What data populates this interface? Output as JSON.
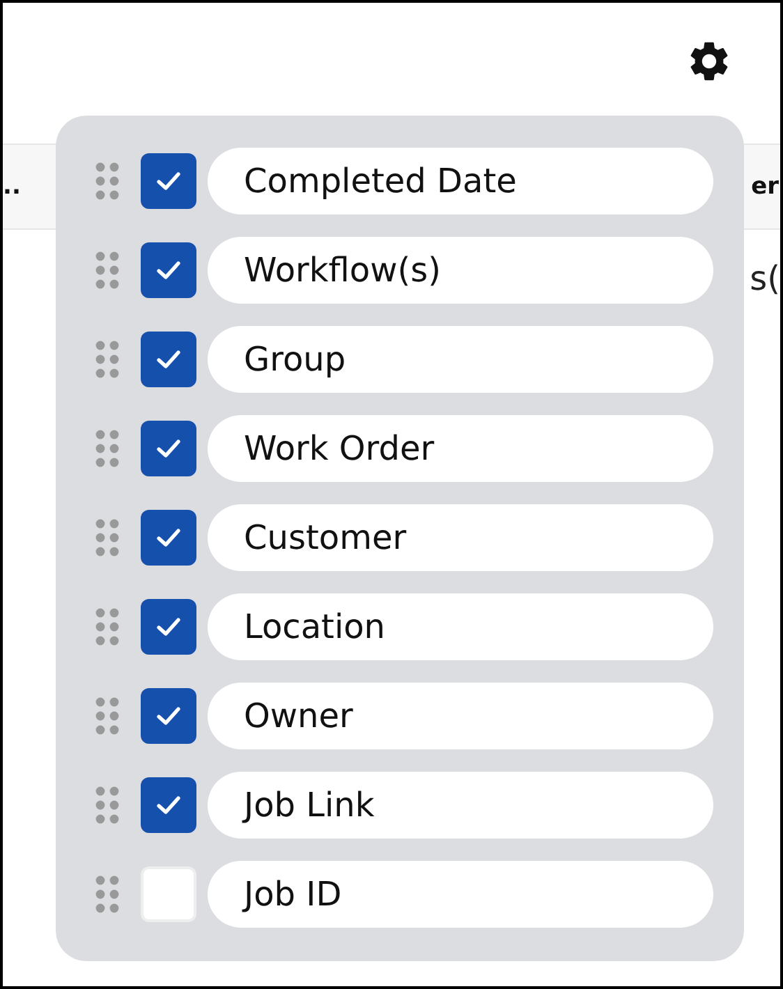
{
  "table": {
    "header_cells": [
      {
        "text": ".."
      },
      {
        "text": "er"
      }
    ],
    "rows": [
      {
        "cells": [
          {
            "text": "s("
          }
        ]
      }
    ]
  },
  "column_picker": {
    "items": [
      {
        "label": "Completed Date",
        "checked": true
      },
      {
        "label": "Workflow(s)",
        "checked": true
      },
      {
        "label": "Group",
        "checked": true
      },
      {
        "label": "Work Order",
        "checked": true
      },
      {
        "label": "Customer",
        "checked": true
      },
      {
        "label": "Location",
        "checked": true
      },
      {
        "label": "Owner",
        "checked": true
      },
      {
        "label": "Job Link",
        "checked": true
      },
      {
        "label": "Job ID",
        "checked": false
      }
    ]
  }
}
